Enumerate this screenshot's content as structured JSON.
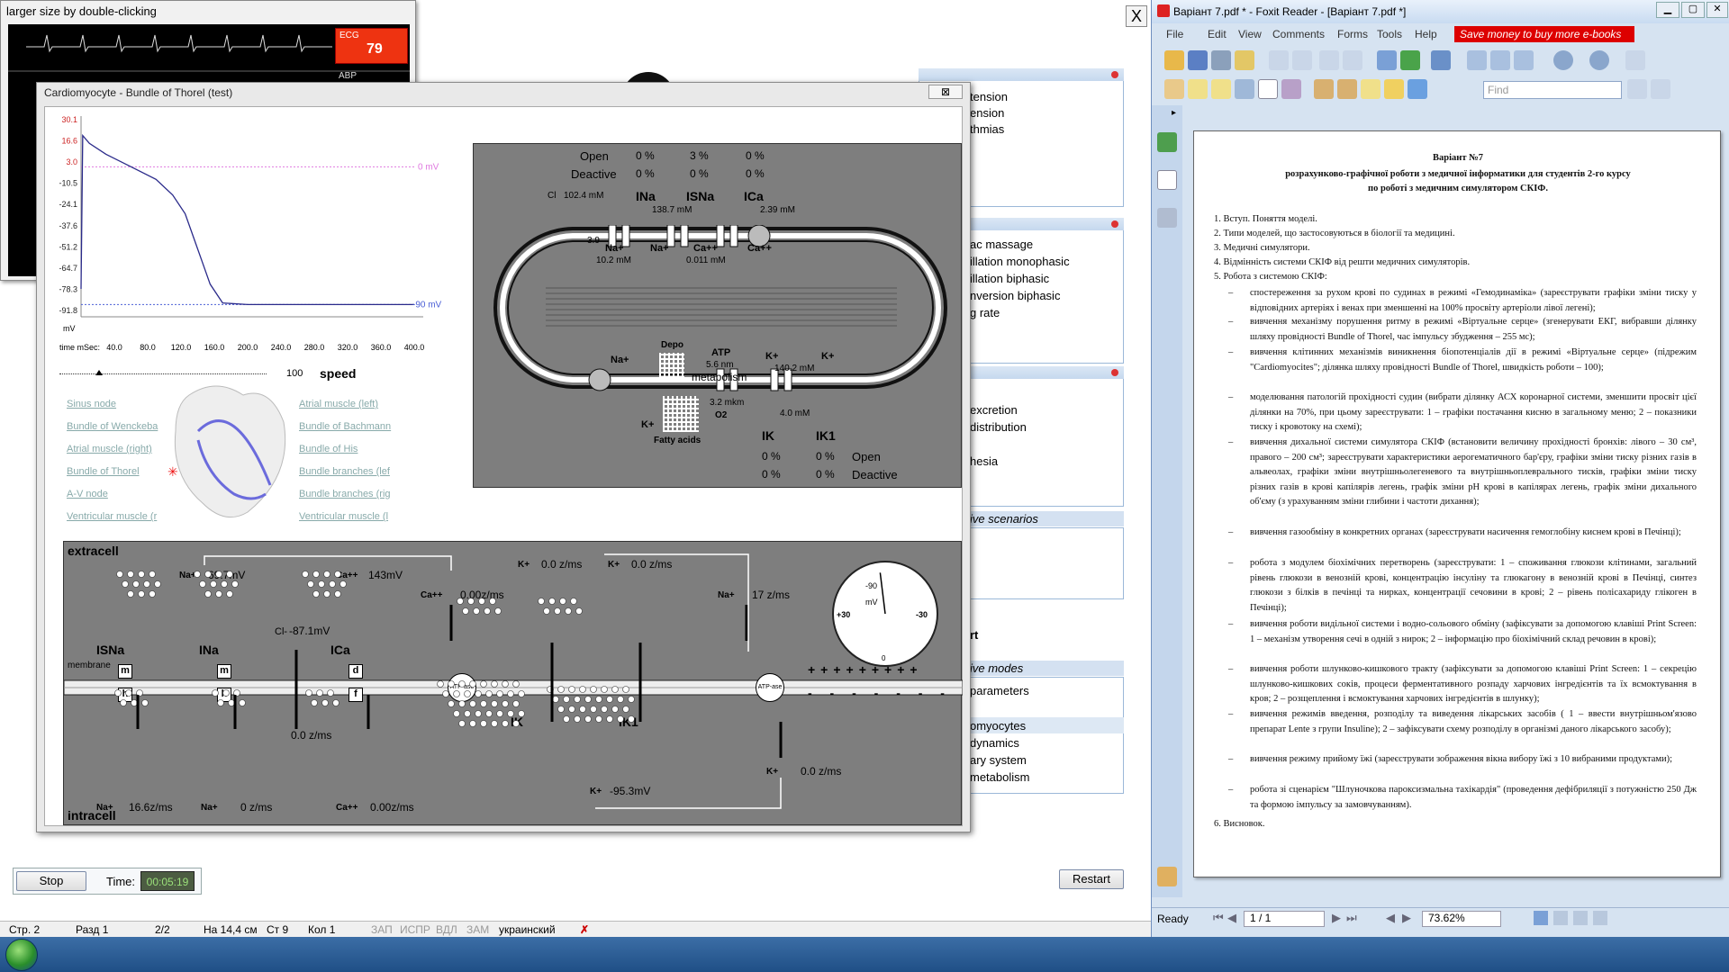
{
  "ecg": {
    "title": "larger size by double-clicking",
    "ecg_label": "ECG",
    "ecg_value": "79",
    "abp_label": "ABP"
  },
  "window": {
    "title": "Cardiomyocyte - Bundle of Thorel  (test)",
    "close_label": "⊠",
    "sim_close": "X"
  },
  "ap_chart": {
    "y_ticks": [
      "30.1",
      "16.6",
      "3.0",
      "-10.5",
      "-24.1",
      "-37.6",
      "-51.2",
      "-64.7",
      "-78.3",
      "-91.8"
    ],
    "x_ticks": [
      "40.0",
      "80.0",
      "120.0",
      "160.0",
      "200.0",
      "240.0",
      "280.0",
      "320.0",
      "360.0",
      "400.0"
    ],
    "x_prefix": "time mSec:",
    "y_unit": "mV",
    "ref_top": "0 mV",
    "ref_bottom": "-90 mV",
    "speed_value": "100",
    "speed_label": "speed",
    "chart_data": {
      "type": "line",
      "ylabel": "mV",
      "xlabel": "time mSec:",
      "xlim": [
        0,
        400
      ],
      "ylim": [
        -91.8,
        30.1
      ],
      "series": [
        {
          "x": [
            0,
            2,
            10,
            30,
            60,
            90,
            110,
            125,
            135,
            145,
            155,
            170,
            200,
            300,
            400
          ],
          "y": [
            -78,
            20,
            15,
            8,
            0,
            -8,
            -18,
            -30,
            -45,
            -60,
            -75,
            -87,
            -88,
            -88,
            -88
          ]
        }
      ]
    }
  },
  "links_left": [
    "Sinus node",
    "Bundle of Wenckeba",
    "Atrial muscle (right)",
    "Bundle of Thorel",
    "A-V node",
    "Ventricular muscle (r"
  ],
  "links_right": [
    "Atrial muscle (left)",
    "Bundle of Bachmann",
    "Bundle of His",
    "Bundle branches (lef",
    "Bundle branches (rig",
    "Ventricular muscle (l"
  ],
  "cell": {
    "open_label": "Open",
    "deactive_label": "Deactive",
    "open_vals": [
      "0 %",
      "3 %",
      "0 %"
    ],
    "deactive_vals": [
      "0 %",
      "0 %",
      "0 %"
    ],
    "cl": "Cl",
    "cl_val": "102.4  mM",
    "ina": "INa",
    "isna": "ISNa",
    "ica": "ICa",
    "na_out": "138.7  mM",
    "ca_out": "2.39  mM",
    "val_39": "3.9",
    "na_plus": "Na+",
    "ca_plus": "Ca++",
    "k_plus": "K+",
    "na_in": "10.2  mM",
    "ca_in": "0.011  mM",
    "depo": "Depo",
    "atp": "ATP",
    "atp_nm": "5.6   nm",
    "metabolism": "metabolism",
    "o2_val": "3.2  mkm",
    "o2": "O2",
    "fatty": "Fatty acids",
    "k_in": "140.2  mM",
    "k_out": "4.0   mM",
    "ik": "IK",
    "ik1": "IK1",
    "bot_open": [
      "0 %",
      "0 %"
    ],
    "bot_deact": [
      "0 %",
      "0 %"
    ]
  },
  "membrane": {
    "extracell": "extracell",
    "intracell": "intracell",
    "membrane": "membrane",
    "na_top": "Na+",
    "na_mv": "69.7mV",
    "ca_top": "Ca++",
    "ca_mv": "143mV",
    "k_top1": "K+",
    "k_flux1": "0.0 z/ms",
    "k_top2": "K+",
    "k_flux2": "0.0 z/ms",
    "ca_right": "Ca++",
    "ca_flux": "0.00z/ms",
    "cl": "Cl-",
    "cl_mv": "-87.1mV",
    "na_right": "Na+",
    "na_flux": "17 z/ms",
    "isna": "ISNa",
    "ina": "INa",
    "ica": "ICa",
    "ik": "IK",
    "ik1": "IK1",
    "gate_m": "m",
    "gate_h": "h",
    "gate_d": "d",
    "gate_f": "f",
    "atpase": "ATP-ase",
    "cl_flux": "0.0 z/ms",
    "k_bottom": "K+",
    "k_bottom_flux": "0.0 z/ms",
    "k_mv": "K+",
    "k_mv_val": "-95.3mV",
    "bot_na1": "Na+",
    "bot_na1_val": "16.6z/ms",
    "bot_na2": "Na+",
    "bot_na2_val": "0  z/ms",
    "bot_ca": "Ca++",
    "bot_ca_val": "0.00z/ms",
    "gauge_top": "-90",
    "gauge_left": "+30",
    "gauge_right": "-30",
    "gauge_bottom": "0",
    "gauge_unit": "mV",
    "gauge_level": -88
  },
  "controls": {
    "stop": "Stop",
    "time_label": "Time:",
    "time_value": "00:05:19",
    "restart": "Restart"
  },
  "right_menu": {
    "group1": [
      "tension",
      "ension",
      "thmias"
    ],
    "group2": [
      "ac massage",
      "illation monophasic",
      "illation biphasic",
      "nversion biphasic",
      "g rate"
    ],
    "group3": [
      "excretion",
      "distribution",
      "hesia"
    ],
    "band1": "ive scenarios",
    "group4_item": "rt",
    "band2": "ive modes",
    "group5": [
      "parameters",
      "omyocytes",
      "dynamics",
      "ary system",
      "metabolism"
    ]
  },
  "word_status": [
    "Стр. 2",
    "Разд 1",
    "2/2",
    "На 14,4 см",
    "Ст 9",
    "Кол 1",
    "ЗАП",
    "ИСПР",
    "ВДЛ",
    "ЗАМ",
    "украинский"
  ],
  "foxit": {
    "title": "Варіант 7.pdf * - Foxit Reader - [Варіант 7.pdf *]",
    "menus": [
      "File",
      "Edit",
      "View",
      "Comments",
      "Forms",
      "Tools",
      "Help"
    ],
    "ad": "Save money to buy more e-books",
    "find_placeholder": "Find",
    "status_ready": "Ready",
    "page": "1 / 1",
    "zoom": "73.62%",
    "doc": {
      "h1": "Варіант №7",
      "h2": "розрахунково-графічної роботи з медичної інформатики для студентів 2-го курсу",
      "h3": "по роботі з медичним симулятором СКІФ.",
      "items": [
        "1. Вступ. Поняття моделі.",
        "2. Типи моделей, що застосовуються в біології та медицині.",
        "3. Медичні симулятори.",
        "4. Відмінність системи СКІФ від решти медичних симуляторів.",
        "5. Робота з системою СКІФ:"
      ],
      "bullets": [
        "спостереження за рухом крові по судинах в режимі «Гемодинаміка» (зареєструвати графіки зміни тиску у відповідних артеріях і венах при зменшенні на 100% просвіту артеріоли лівої легені);",
        "вивчення механізму порушення ритму в режимі «Віртуальне серце» (згенерувати ЕКГ, вибравши ділянку шляху провідності Bundle of Thorel, час імпульсу збудження – 255 мс);",
        "вивчення клітинних механізмів виникнення біопотенціалів дії в режимі «Віртуальне серце» (підрежим \"Cardiomyocites\"; ділянка шляху провідності Bundle of Thorel, швидкість роботи – 100);",
        "моделювання патологій прохідності судин (вибрати ділянку АСХ коронарної системи, зменшити просвіт цієї ділянки на 70%, при цьому зареєструвати: 1 – графіки постачання кисню в загальному меню; 2 – показники тиску і кровотоку на схемі);",
        "вивчення дихальної системи симулятора СКІФ (встановити величину прохідності бронхів: лівого – 30 см³, правого – 200 см³; зареєструвати характеристики аерогематичного бар'єру, графіки зміни тиску різних газів в альвеолах, графіки зміни внутрішньолегеневого та внутрішньоплеврального тисків, графіки зміни тиску різних газів в крові капілярів легень, графік зміни рН крові в капілярах легень, графік зміни дихального об'єму (з урахуванням зміни глибини і частоти дихання);",
        "вивчення газообміну в конкретних органах (зареєструвати насичення гемоглобіну киснем крові в Печінці);",
        "робота з модулем біохімічних перетворень (зареєструвати: 1 – споживання глюкози клітинами, загальний рівень глюкози в венозній крові, концентрацію інсуліну та глюкагону в венозній крові в Печінці, синтез глюкози з білків в печінці та нирках, концентрації сечовини в крові; 2 – рівень полісахариду глікоген в Печінці);",
        "вивчення роботи видільної системи і водно-сольового обміну (зафіксувати за допомогою клавіші Print Screen: 1 – механізм утворення сечі в одній з нирок; 2 – інформацію про біохімічний склад речовин в крові);",
        "вивчення роботи шлунково-кишкового тракту (зафіксувати за допомогою клавіші Print Screen: 1 – секрецію шлунково-кишкових соків, процеси ферментативного розпаду харчових інгредієнтів та їх всмоктування в кров; 2 – розщеплення і всмоктування харчових інгредієнтів в шлунку);",
        "вивчення режимів введення, розподілу та виведення лікарських засобів ( 1 – ввести внутрішньом'язово препарат Lente з групи Insuline); 2 – зафіксувати схему розподілу в організмі даного лікарського засобу);",
        "вивчення режиму прийому їжі (зареєструвати зображення вікна вибору їжі з 10 вибраними продуктами);",
        "робота зі сценарієм \"Шлуночкова пароксизмальна тахікардія\" (проведення дефібриляції з потужністю 250 Дж та формою імпульсу за замовчуванням)."
      ],
      "last": "6. Висновок."
    }
  },
  "colors": {
    "panel_gray": "#7e7e7e",
    "ecg_red": "#e31",
    "chart_line": "#2a2a8a",
    "ad_red": "#d00"
  }
}
